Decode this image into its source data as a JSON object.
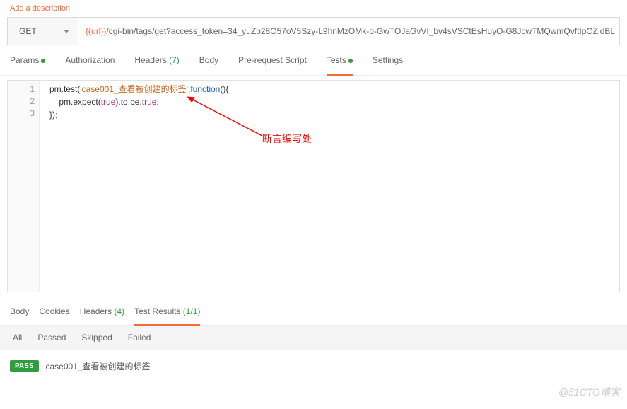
{
  "header": {
    "add_description": "Add a description"
  },
  "request": {
    "method": "GET",
    "url_variable": "{{url}}",
    "url_path": "/cgi-bin/tags/get?access_token=34_yuZb28O57oV5Szy-L9hnMzOMk-b-GwTOJaGvVI_bv4sVSCtEsHuyO-G8JcwTMQwmQvftIpOZidBL"
  },
  "tabs": {
    "params": "Params",
    "authorization": "Authorization",
    "headers": "Headers",
    "headers_count": "(7)",
    "body": "Body",
    "prerequest": "Pre-request Script",
    "tests": "Tests",
    "settings": "Settings"
  },
  "code": {
    "line1_a": "pm.test(",
    "line1_b": "'case001_查看被创建的标签'",
    "line1_c": ",",
    "line1_d": "function",
    "line1_e": "(){",
    "line2_a": "    pm.expect(",
    "line2_b": "true",
    "line2_c": ").to.be.",
    "line2_d": "true",
    "line2_e": ";",
    "line3": "});",
    "ln1": "1",
    "ln2": "2",
    "ln3": "3"
  },
  "annotation": {
    "label": "断言编写处"
  },
  "response_tabs": {
    "body": "Body",
    "cookies": "Cookies",
    "headers": "Headers",
    "headers_count": "(4)",
    "test_results": "Test Results",
    "test_results_count": "(1/1)"
  },
  "filters": {
    "all": "All",
    "passed": "Passed",
    "skipped": "Skipped",
    "failed": "Failed"
  },
  "result": {
    "badge": "PASS",
    "name": "case001_查看被创建的标签"
  },
  "watermark": "@51CTO博客"
}
